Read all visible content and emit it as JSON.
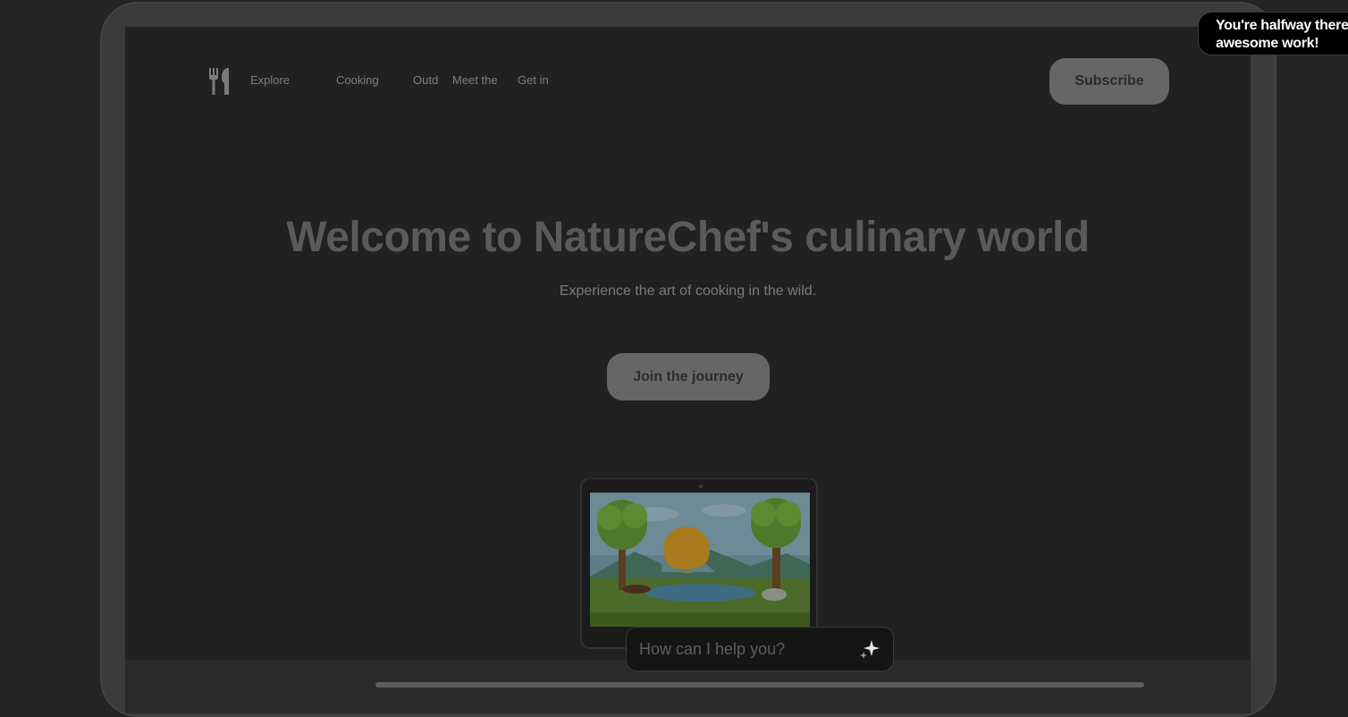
{
  "nav": {
    "logo_icon": "fork-knife-icon",
    "links": [
      "Explore",
      "Cooking",
      "Outd",
      "Meet the",
      "Get in"
    ],
    "subscribe_label": "Subscribe"
  },
  "hero": {
    "title": "Welcome to NatureChef's culinary world",
    "subtitle": "Experience the art of cooking in the wild.",
    "cta_label": "Join the journey"
  },
  "chat": {
    "placeholder": "How can I help you?",
    "icon": "sparkle-icon"
  },
  "toast": {
    "line1": "You're halfway there",
    "line2": "awesome work!"
  },
  "colors": {
    "page_bg": "#242424",
    "screen_bg": "#212121",
    "button_bg": "#666666",
    "toast_bg": "#000000"
  }
}
